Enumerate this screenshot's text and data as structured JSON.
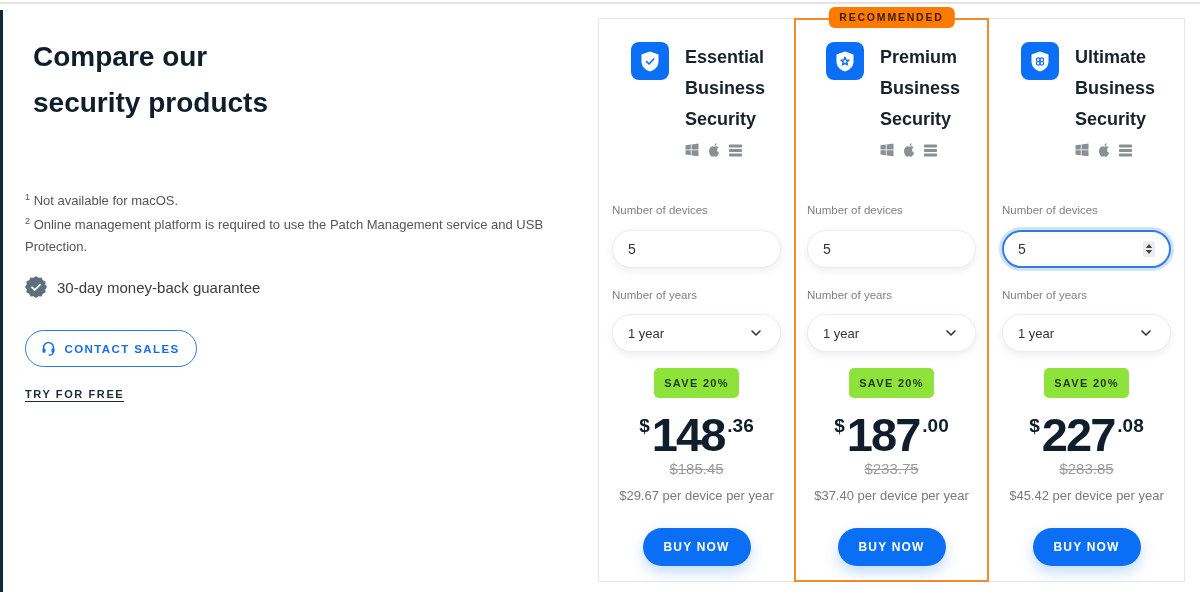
{
  "intro": {
    "heading": "Compare our security products",
    "footnotes": [
      "$^{1}$ Not available for macOS.",
      "$^{2}$ Online management platform is required to use the Patch Management service and USB Protection."
    ],
    "guarantee": "30-day money-back guarantee",
    "contact_button": "CONTACT SALES",
    "trial_link": "TRY FOR FREE"
  },
  "plans": [
    {
      "name": "Essential Business Security",
      "recommended": false,
      "devices_label": "Number of devices",
      "devices": {
        "value": "5",
        "focused": false
      },
      "years_label": "Number of years",
      "years": "1 year",
      "discount": "SAVE 20%",
      "price": {
        "currency": "$",
        "whole": "148",
        "cents": ".36"
      },
      "old_price": "$185.45",
      "per_device": "$29.67 per device per year",
      "button": "BUY NOW"
    },
    {
      "name": "Premium Business Security",
      "recommended": true,
      "badge": "RECOMMENDED",
      "devices_label": "Number of devices",
      "devices": {
        "value": "5",
        "focused": false
      },
      "years_label": "Number of years",
      "years": "1 year",
      "discount": "SAVE 20%",
      "price": {
        "currency": "$",
        "whole": "187",
        "cents": ".00"
      },
      "old_price": "$233.75",
      "per_device": "$37.40 per device per year",
      "button": "BUY NOW"
    },
    {
      "name": "Ultimate Business Security",
      "recommended": false,
      "devices_label": "Number of devices",
      "devices": {
        "value": "5",
        "focused": true
      },
      "years_label": "Number of years",
      "years": "1 year",
      "discount": "SAVE 20%",
      "price": {
        "currency": "$",
        "whole": "227",
        "cents": ".08"
      },
      "old_price": "$283.85",
      "per_device": "$45.42 per device per year",
      "button": "BUY NOW"
    }
  ]
}
